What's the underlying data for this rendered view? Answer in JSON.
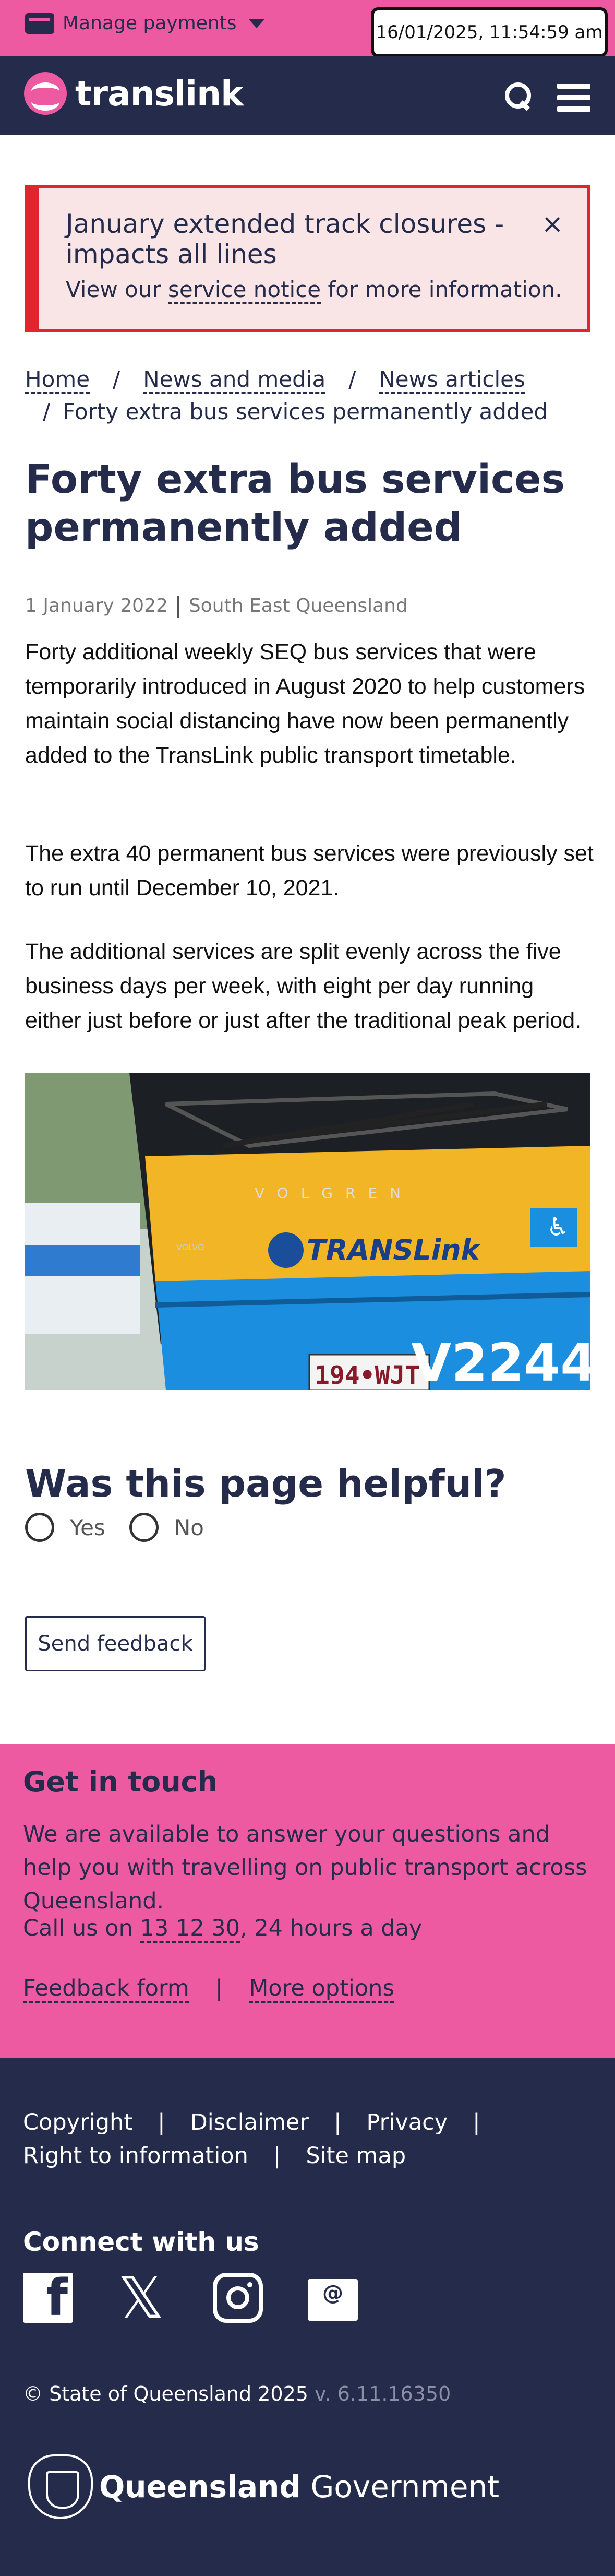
{
  "topbar": {
    "manage_label": "Manage payments",
    "datetime": "16/01/2025, 11:54:59 am"
  },
  "nav": {
    "logo_text": "translink"
  },
  "alert": {
    "title": "January extended track closures - impacts all lines",
    "close": "×",
    "desc_prefix": "View our",
    "desc_link": "service notice",
    "desc_suffix": "for more information."
  },
  "breadcrumb": {
    "home": "Home",
    "news_media": "News and media",
    "news_articles": "News articles",
    "current": "Forty extra bus services permanently added",
    "sep": "/"
  },
  "article": {
    "title": "Forty extra bus services permanently added",
    "date": "1 January 2022",
    "region": "South East Queensland",
    "paragraphs": [
      "Forty additional weekly SEQ bus services that were temporarily introduced in August 2020 to help customers maintain social distancing have now been permanently added to the TransLink public transport timetable.",
      "The extra 40 permanent bus services were previously set to run until December 10, 2021.",
      "The additional services are split evenly across the five business days per week, with eight per day running either just before or just after the traditional peak period."
    ],
    "image": {
      "brand": "VOLGREN",
      "logo": "TRANSLink",
      "plate": "194•WJT",
      "fleet": "V2244",
      "make": "VOLVO"
    }
  },
  "feedback": {
    "question": "Was this page helpful?",
    "yes": "Yes",
    "no": "No",
    "send": "Send feedback"
  },
  "contact": {
    "heading": "Get in touch",
    "text": "We are available to answer your questions and help you with travelling on public transport across Queensland.",
    "call_prefix": "Call us on",
    "phone": "13 12 30",
    "call_suffix": ", 24 hours a day",
    "feedback_form": "Feedback form",
    "more_options": "More options",
    "sep": "|"
  },
  "footer": {
    "links": [
      "Copyright",
      "Disclaimer",
      "Privacy",
      "Right to information",
      "Site map"
    ],
    "sep": "|",
    "connect": "Connect with us",
    "copyright": "© State of Queensland 2025",
    "version": "v. 6.11.16350",
    "qgov_bold": "Queensland",
    "qgov_rest": "Government"
  },
  "colors": {
    "navy": "#252b4b",
    "pink": "#ee5aa2",
    "alert_red": "#e0252f",
    "alert_bg": "#f9e4e6"
  }
}
